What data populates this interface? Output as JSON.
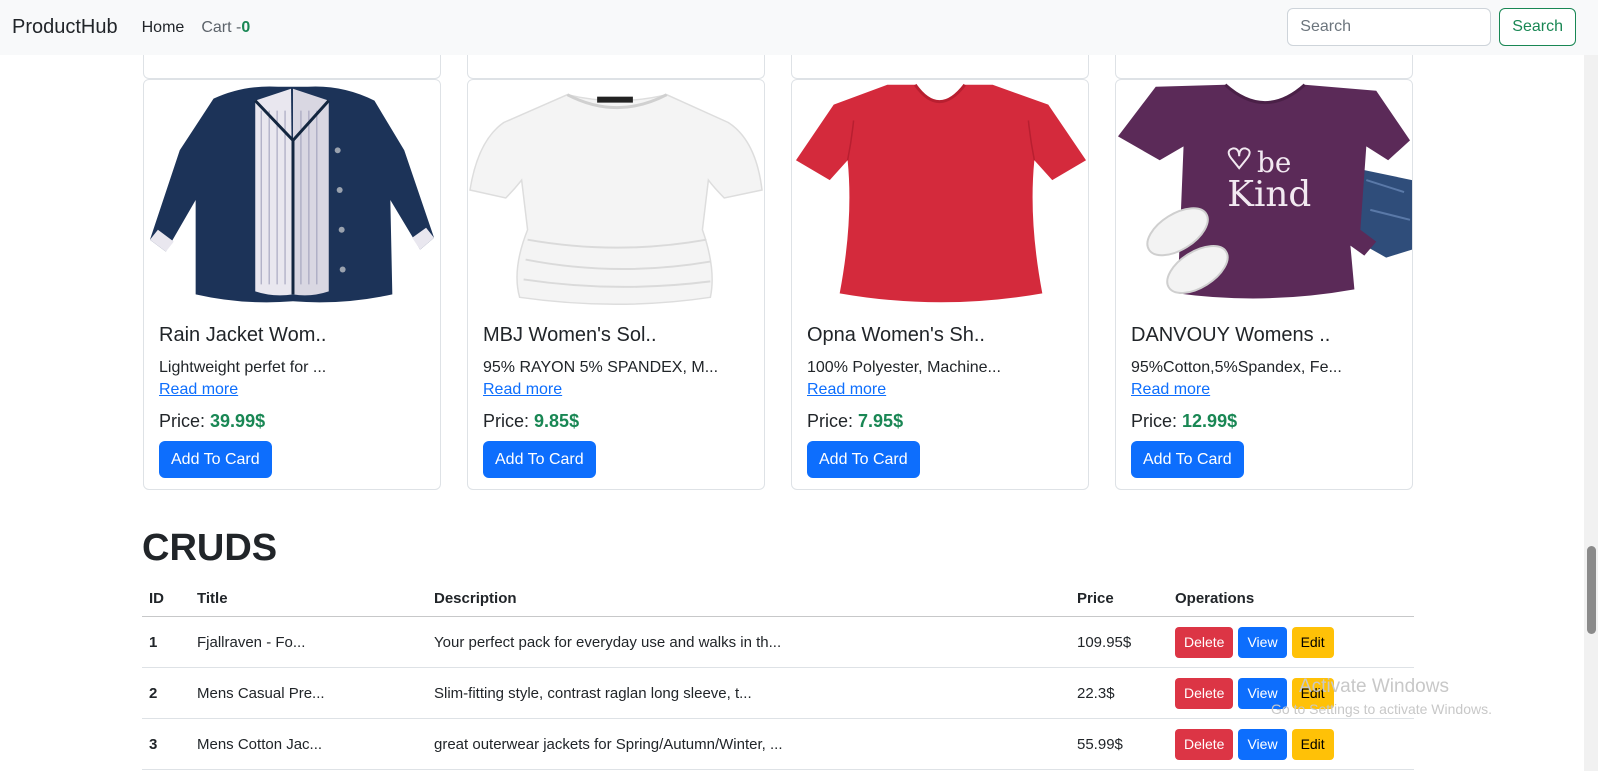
{
  "navbar": {
    "brand": "ProductHub",
    "home_label": "Home",
    "cart_label": "Cart -",
    "cart_count": "0",
    "search_placeholder": "Search",
    "search_button": "Search"
  },
  "products": [
    {
      "title": "Rain Jacket Wom..",
      "description": "Lightweight perfet for ...",
      "read_more": "Read more",
      "price_label": "Price:",
      "price": "39.99$",
      "button": "Add To Card",
      "image": "navy-rain-jacket-icon"
    },
    {
      "title": "MBJ Women's Sol..",
      "description": "95% RAYON 5% SPANDEX, M...",
      "read_more": "Read more",
      "price_label": "Price:",
      "price": "9.85$",
      "button": "Add To Card",
      "image": "white-top-icon"
    },
    {
      "title": "Opna Women's Sh..",
      "description": "100% Polyester, Machine...",
      "read_more": "Read more",
      "price_label": "Price:",
      "price": "7.95$",
      "button": "Add To Card",
      "image": "red-tshirt-icon"
    },
    {
      "title": "DANVOUY Womens ..",
      "description": "95%Cotton,5%Spandex, Fe...",
      "read_more": "Read more",
      "price_label": "Price:",
      "price": "12.99$",
      "button": "Add To Card",
      "image": "purple-be-kind-tshirt-icon",
      "image_text": [
        "be",
        "Kind"
      ]
    }
  ],
  "cruds": {
    "heading": "CRUDS",
    "columns": [
      "ID",
      "Title",
      "Description",
      "Price",
      "Operations"
    ],
    "rows": [
      {
        "id": "1",
        "title": "Fjallraven - Fo...",
        "description": "Your perfect pack for everyday use and walks in th...",
        "price": "109.95$"
      },
      {
        "id": "2",
        "title": "Mens Casual Pre...",
        "description": "Slim-fitting style, contrast raglan long sleeve, t...",
        "price": "22.3$"
      },
      {
        "id": "3",
        "title": "Mens Cotton Jac...",
        "description": "great outerwear jackets for Spring/Autumn/Winter, ...",
        "price": "55.99$"
      }
    ],
    "operations": {
      "delete": "Delete",
      "view": "View",
      "edit": "Edit"
    }
  },
  "watermark": {
    "title": "Activate Windows",
    "subtitle": "Go to Settings to activate Windows."
  },
  "colors": {
    "primary": "#0d6efd",
    "success": "#198754",
    "danger": "#dc3545",
    "warning": "#ffc107",
    "navbar_bg": "#f8f9fa"
  }
}
